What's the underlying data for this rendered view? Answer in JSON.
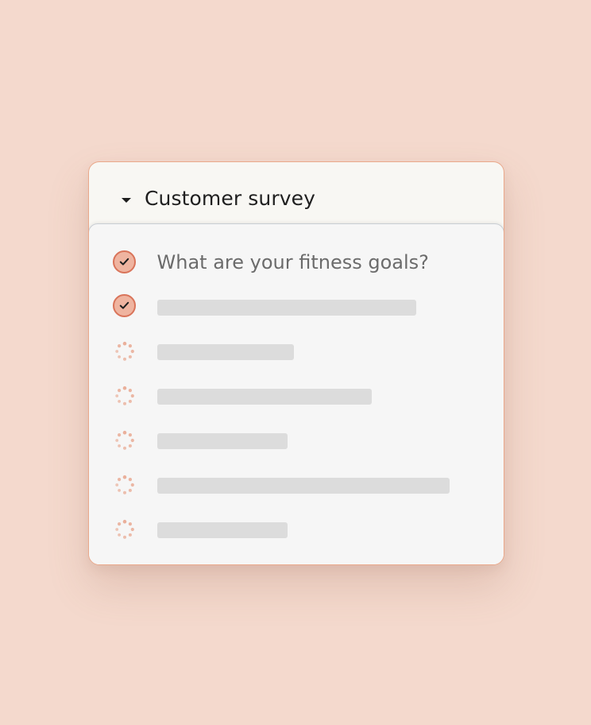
{
  "survey": {
    "title": "Customer survey",
    "items": [
      {
        "status": "done",
        "text": "What are your fitness goals?"
      },
      {
        "status": "done",
        "text": ""
      },
      {
        "status": "loading",
        "text": ""
      },
      {
        "status": "loading",
        "text": ""
      },
      {
        "status": "loading",
        "text": ""
      },
      {
        "status": "loading",
        "text": ""
      },
      {
        "status": "loading",
        "text": ""
      }
    ]
  },
  "colors": {
    "background": "#f4d9cd",
    "card": "#f8f7f3",
    "card_border": "#eaa88a",
    "panel": "#f6f6f6",
    "check_fill": "#efb4a0",
    "check_border": "#d9745a",
    "spinner": "#eab09b",
    "placeholder_bar": "#dcdcdc"
  },
  "icons": {
    "collapse": "caret-down-icon",
    "done": "check-circle-icon",
    "loading": "spinner-icon"
  }
}
